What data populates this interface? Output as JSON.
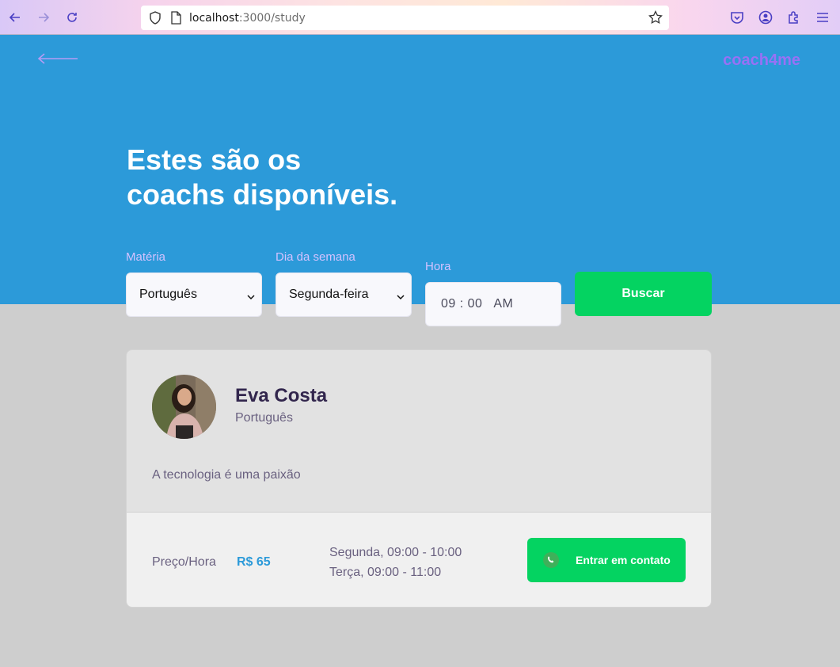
{
  "browser": {
    "url_host": "localhost",
    "url_path": ":3000/study"
  },
  "header": {
    "logo": "coach4me",
    "title_line1": "Estes são os",
    "title_line2": "coachs disponíveis."
  },
  "filters": {
    "subject_label": "Matéria",
    "subject_value": "Português",
    "weekday_label": "Dia da semana",
    "weekday_value": "Segunda-feira",
    "time_label": "Hora",
    "time_value": "09 : 00   AM",
    "search_button": "Buscar"
  },
  "coach": {
    "name": "Eva Costa",
    "subject": "Português",
    "bio": "A tecnologia é uma paixão",
    "price_label": "Preço/Hora",
    "price_value": "R$ 65",
    "schedule": [
      "Segunda, 09:00 - 10:00",
      "Terça, 09:00 - 11:00"
    ],
    "contact_button": "Entrar em contato"
  },
  "colors": {
    "primary": "#2c9ad9",
    "secondary": "#04d361",
    "logo": "#9871f5",
    "background": "#cecece"
  }
}
